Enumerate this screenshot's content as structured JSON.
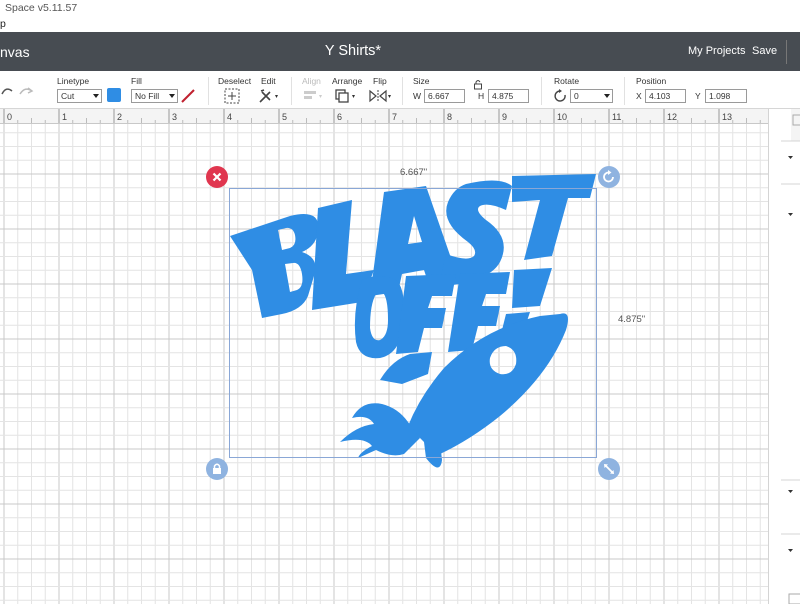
{
  "titlebar": {
    "text": "Space  v5.11.57"
  },
  "menubar": {
    "text": "p"
  },
  "header": {
    "left_label": "nvas",
    "project_title": "Y Shirts*",
    "my_projects": "My Projects",
    "save": "Save"
  },
  "toolbar": {
    "linetype_label": "Linetype",
    "linetype_value": "Cut",
    "fill_label": "Fill",
    "fill_value": "No Fill",
    "fill_color": "#2f8de4",
    "deselect_label": "Deselect",
    "edit_label": "Edit",
    "align_label": "Align",
    "arrange_label": "Arrange",
    "flip_label": "Flip",
    "size_label": "Size",
    "size_w_label": "W",
    "size_w_value": "6.667",
    "size_h_label": "H",
    "size_h_value": "4.875",
    "rotate_label": "Rotate",
    "rotate_value": "0",
    "position_label": "Position",
    "pos_x_label": "X",
    "pos_x_value": "4.103",
    "pos_y_label": "Y",
    "pos_y_value": "1.098"
  },
  "ruler": {
    "ticks": [
      "0",
      "1",
      "2",
      "3",
      "4",
      "5",
      "6",
      "7",
      "8",
      "9",
      "10",
      "11",
      "12",
      "13"
    ]
  },
  "selection": {
    "width_label": "6.667\"",
    "height_label": "4.875\""
  },
  "design": {
    "line1": "BLAST",
    "line2": "OFF!",
    "color": "#2f8de4"
  },
  "colors": {
    "header_bg": "#474c52",
    "delete_handle": "#e0364f",
    "handle_blue": "#8fb3e0",
    "grid_minor": "#e4e4e4",
    "grid_major": "#c8c8c8"
  }
}
